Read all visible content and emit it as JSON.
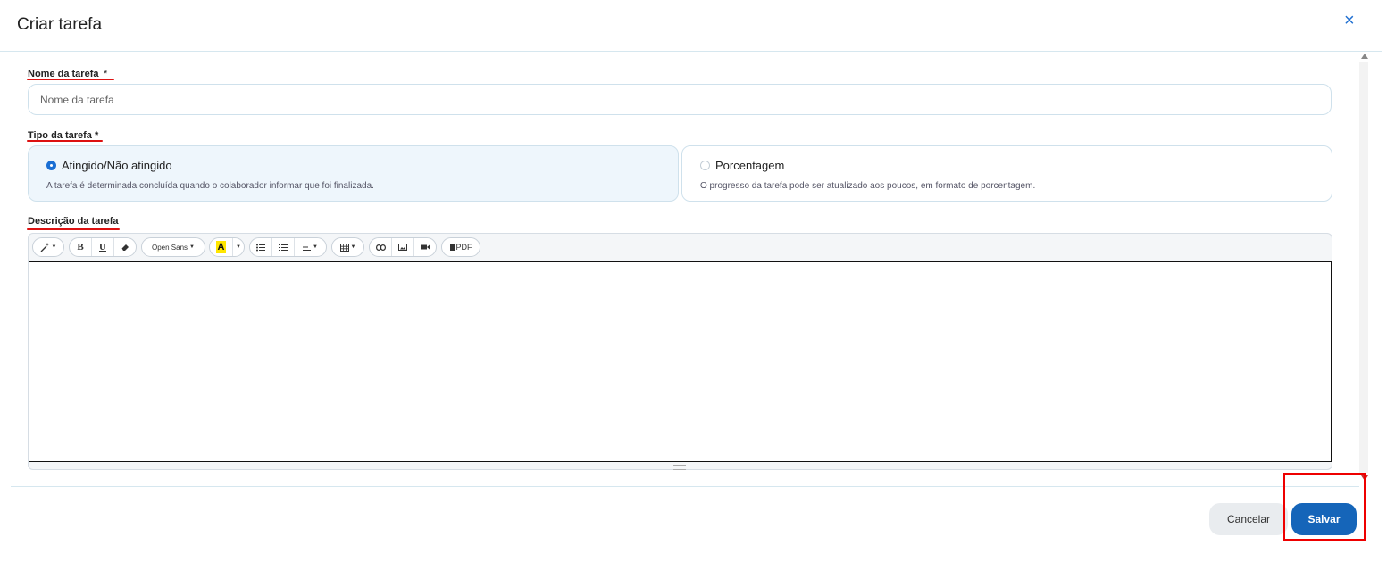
{
  "dialog": {
    "title": "Criar tarefa",
    "close_icon": "×"
  },
  "form": {
    "name": {
      "label": "Nome da tarefa",
      "required_mark": "*",
      "placeholder": "Nome da tarefa",
      "value": ""
    },
    "type": {
      "label": "Tipo da tarefa *",
      "options": [
        {
          "title": "Atingido/Não atingido",
          "description": "A tarefa é determinada concluída quando o colaborador informar que foi finalizada.",
          "selected": true
        },
        {
          "title": "Porcentagem",
          "description": "O progresso da tarefa pode ser atualizado aos poucos, em formato de porcentagem.",
          "selected": false
        }
      ]
    },
    "description": {
      "label": "Descrição da tarefa",
      "value": "",
      "toolbar": {
        "style_icon": "magic-wand-icon",
        "bold": "B",
        "underline": "U",
        "eraser_icon": "eraser-icon",
        "font_family": "Open Sans",
        "color_letter": "A",
        "unordered_list_icon": "unordered-list-icon",
        "ordered_list_icon": "ordered-list-icon",
        "align_icon": "align-icon",
        "table_icon": "table-icon",
        "link_icon": "link-icon",
        "image_icon": "image-icon",
        "video_icon": "video-icon",
        "pdf_label": "PDF"
      }
    }
  },
  "footer": {
    "cancel_label": "Cancelar",
    "save_label": "Salvar"
  },
  "colors": {
    "primary": "#1565b9",
    "accent_blue": "#1a6fd4",
    "annotation_red": "#dd1111",
    "selected_card_bg": "#eef6fc"
  }
}
